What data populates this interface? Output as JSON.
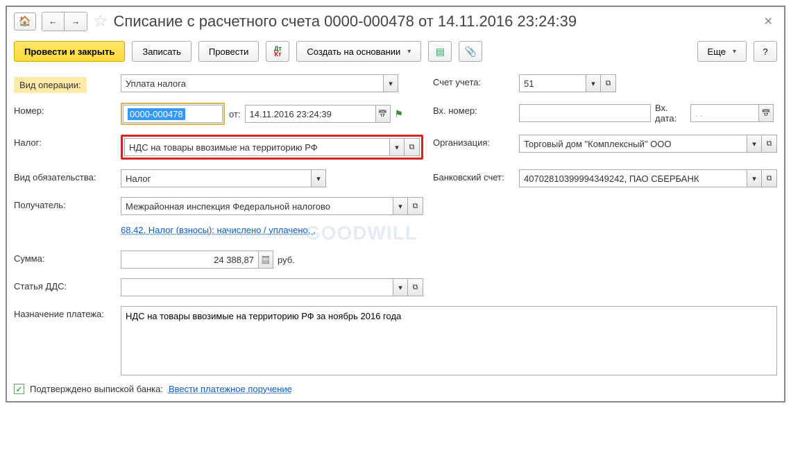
{
  "title": "Списание с расчетного счета 0000-000478 от 14.11.2016 23:24:39",
  "toolbar": {
    "post_close": "Провести и закрыть",
    "save": "Записать",
    "post": "Провести",
    "create_based": "Создать на основании",
    "more": "Еще"
  },
  "labels": {
    "op_type": "Вид операции:",
    "account": "Счет учета:",
    "number": "Номер:",
    "from": "от:",
    "in_number": "Вх. номер:",
    "in_date": "Вх. дата:",
    "tax": "Налог:",
    "org": "Организация:",
    "liab_type": "Вид обязательства:",
    "bank_acc": "Банковский счет:",
    "recipient": "Получатель:",
    "sum": "Сумма:",
    "currency": "руб.",
    "dds": "Статья ДДС:",
    "purpose": "Назначение платежа:",
    "confirmed": "Подтверждено выпиской банка:",
    "enter_payment": "Ввести платежное поручение"
  },
  "values": {
    "op_type": "Уплата налога",
    "account": "51",
    "number": "0000-000478",
    "date": "14.11.2016 23:24:39",
    "in_number": "",
    "in_date": "  .  .",
    "tax": "НДС на товары ввозимые на территорию РФ",
    "org": "Торговый дом \"Комплексный\" ООО",
    "liab_type": "Налог",
    "bank_acc": "40702810399994349242, ПАО СБЕРБАНК",
    "recipient": "Межрайонная инспекция Федеральной налогово",
    "kbk_link": "68.42, Налог (взносы): начислено / уплачено, ,",
    "sum": "24 388,87",
    "dds": "",
    "purpose": "НДС на товары ввозимые на территорию РФ за ноябрь 2016 года"
  }
}
